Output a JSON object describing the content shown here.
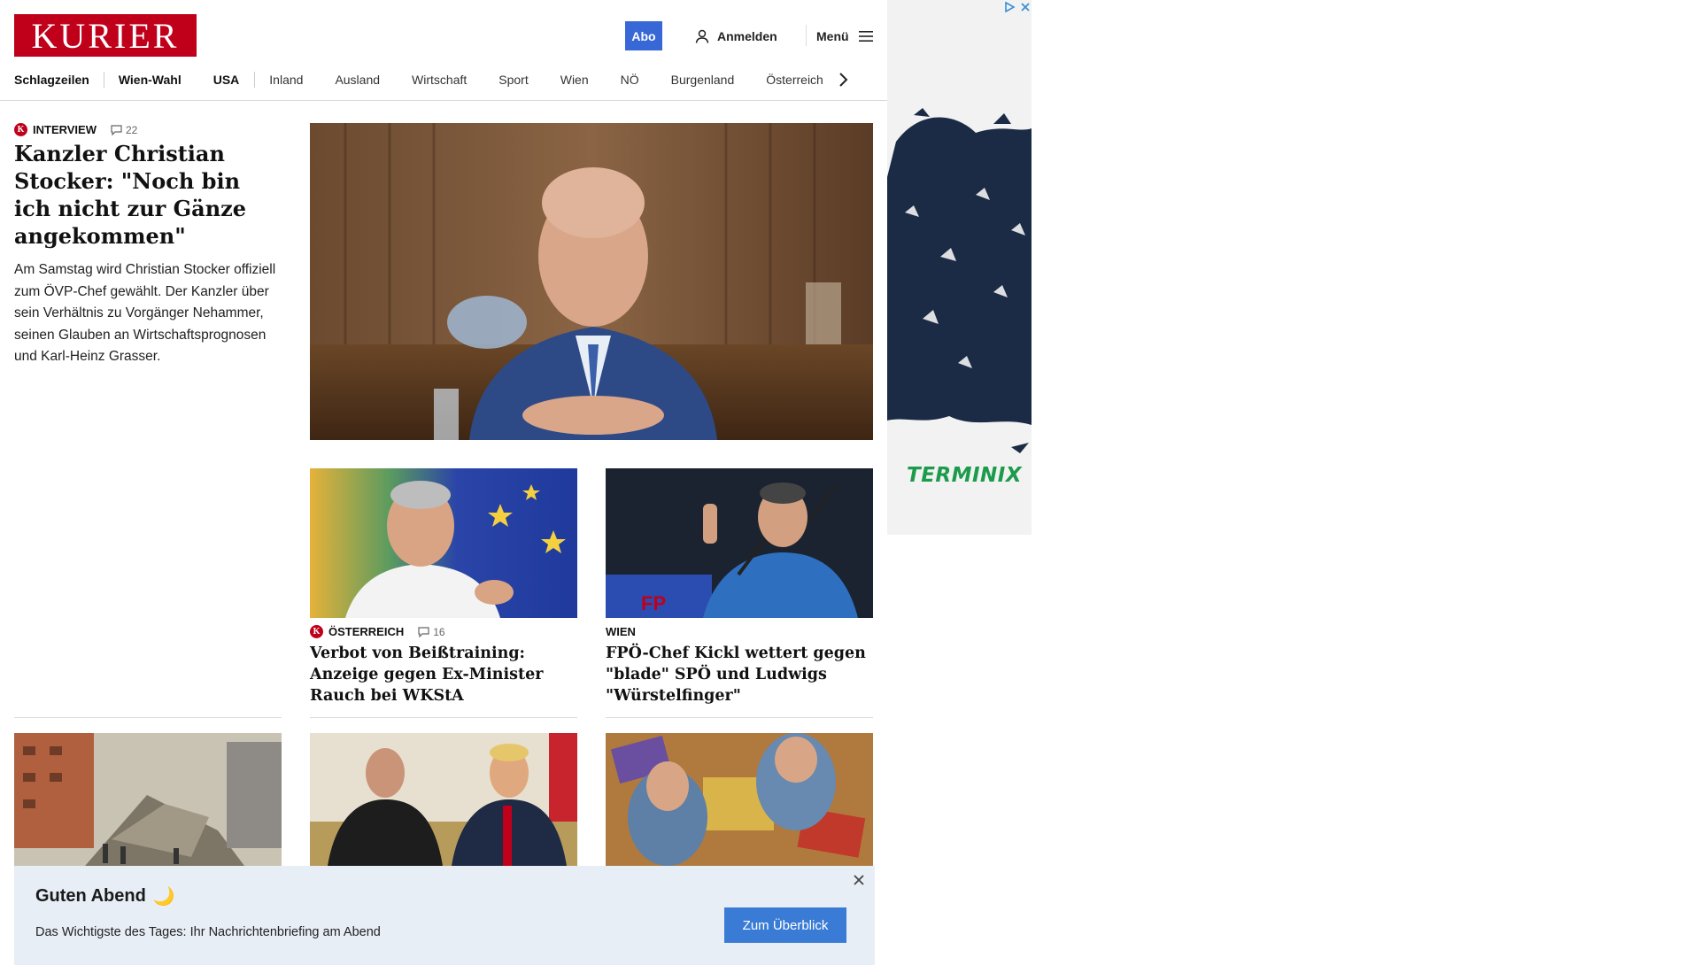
{
  "header": {
    "logo": "KURIER",
    "abo_label": "Abo",
    "login_label": "Anmelden",
    "menu_label": "Menü"
  },
  "nav": {
    "items": [
      "Schlagzeilen",
      "Wien-Wahl",
      "USA",
      "Inland",
      "Ausland",
      "Wirtschaft",
      "Sport",
      "Wien",
      "NÖ",
      "Burgenland",
      "Österreich"
    ]
  },
  "lead": {
    "kicker": "INTERVIEW",
    "comments": "22",
    "title": "Kanzler Christian Stocker: \"Noch bin ich nicht zur Gänze angekommen\"",
    "text": "Am Samstag wird Christian Stocker offiziell zum ÖVP-Chef gewählt. Der Kanzler über sein Verhältnis zu Vorgänger Nehammer, seinen Glauben an Wirtschaftsprognosen und Karl-Heinz Grasser."
  },
  "stories": [
    {
      "kicker": "ÖSTERREICH",
      "comments": "16",
      "title": "Verbot von Beißtraining: Anzeige gegen Ex-Minister Rauch bei WKStA"
    },
    {
      "kicker": "WIEN",
      "title": "FPÖ-Chef Kickl wettert gegen \"blade\" SPÖ und Ludwigs \"Würstelfinger\""
    }
  ],
  "ad": {
    "brand": "TERMINIX"
  },
  "briefing": {
    "title": "Guten Abend",
    "emoji": "🌙",
    "subtitle": "Das Wichtigste des Tages: Ihr Nachrichtenbriefing am Abend",
    "button": "Zum Überblick"
  },
  "colors": {
    "brand_red": "#c0001b",
    "abo_blue": "#3867d6",
    "button_blue": "#3a7bd5",
    "banner_bg": "#e8eef6",
    "ad_green": "#1c9b4c"
  },
  "icons": [
    "person-icon",
    "hamburger-menu-icon",
    "chevron-right-icon",
    "comment-icon",
    "close-icon",
    "adchoices-icon"
  ]
}
